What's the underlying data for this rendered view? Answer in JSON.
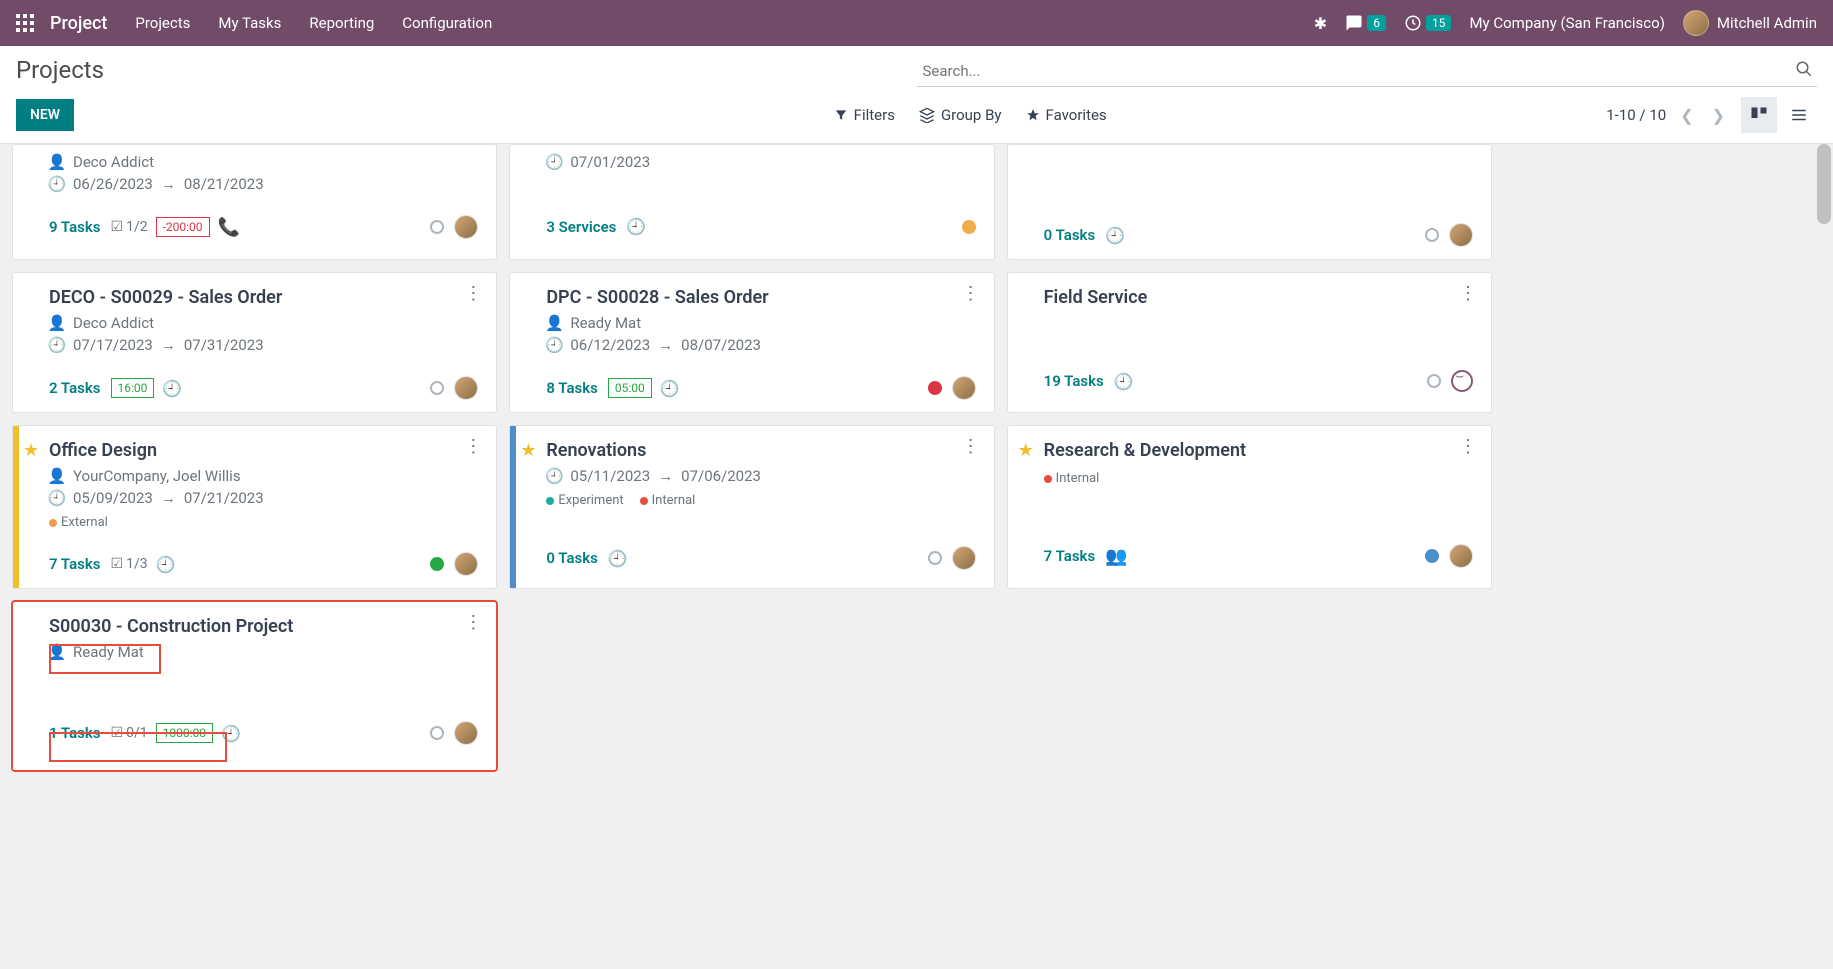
{
  "nav": {
    "brand": "Project",
    "links": [
      "Projects",
      "My Tasks",
      "Reporting",
      "Configuration"
    ],
    "chat_badge": "6",
    "activity_badge": "15",
    "company": "My Company (San Francisco)",
    "user": "Mitchell Admin"
  },
  "control": {
    "title": "Projects",
    "new_btn": "NEW",
    "search_placeholder": "Search...",
    "filters": "Filters",
    "groupby": "Group By",
    "favorites": "Favorites",
    "pager": "1-10 / 10"
  },
  "cards": {
    "c1": {
      "partner": "Deco Addict",
      "date1": "06/26/2023",
      "date2": "08/21/2023",
      "tasks": "9 Tasks",
      "sub": "1/2",
      "time": "-200:00"
    },
    "c2": {
      "date1": "07/01/2023",
      "tasks": "3 Services"
    },
    "c3": {
      "tasks": "0 Tasks"
    },
    "c4": {
      "title": "DECO - S00029 - Sales Order",
      "partner": "Deco Addict",
      "date1": "07/17/2023",
      "date2": "07/31/2023",
      "tasks": "2 Tasks",
      "time": "16:00"
    },
    "c5": {
      "title": "DPC - S00028 - Sales Order",
      "partner": "Ready Mat",
      "date1": "06/12/2023",
      "date2": "08/07/2023",
      "tasks": "8 Tasks",
      "time": "05:00"
    },
    "c6": {
      "title": "Field Service",
      "tasks": "19 Tasks"
    },
    "c7": {
      "title": "Office Design",
      "partner": "YourCompany, Joel Willis",
      "date1": "05/09/2023",
      "date2": "07/21/2023",
      "tag1": "External",
      "tasks": "7 Tasks",
      "sub": "1/3"
    },
    "c8": {
      "title": "Renovations",
      "date1": "05/11/2023",
      "date2": "07/06/2023",
      "tag1": "Experiment",
      "tag2": "Internal",
      "tasks": "0 Tasks"
    },
    "c9": {
      "title": "Research & Development",
      "tag1": "Internal",
      "tasks": "7 Tasks"
    },
    "c10": {
      "title": "S00030 - Construction Project",
      "partner": "Ready Mat",
      "tasks": "1 Tasks",
      "sub": "0/1",
      "time": "1000:00"
    }
  }
}
